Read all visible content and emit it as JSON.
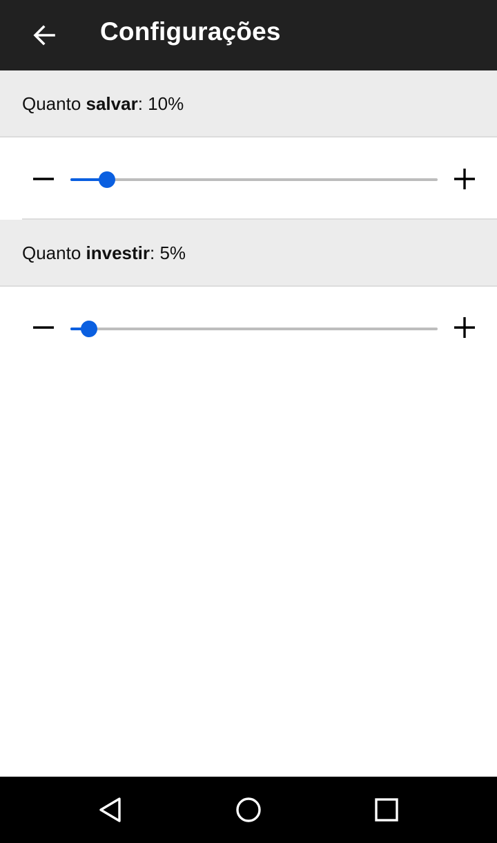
{
  "app_bar": {
    "title": "Configurações",
    "back_icon": "arrow-left-icon"
  },
  "settings": [
    {
      "label_prefix": "Quanto ",
      "label_bold": "salvar",
      "label_suffix": ": ",
      "value_text": "10%",
      "value_fraction": 0.1,
      "minus_icon": "minus-icon",
      "plus_icon": "plus-icon"
    },
    {
      "label_prefix": "Quanto ",
      "label_bold": "investir",
      "label_suffix": ": ",
      "value_text": "5%",
      "value_fraction": 0.05,
      "minus_icon": "minus-icon",
      "plus_icon": "plus-icon"
    }
  ],
  "nav_bar": {
    "back_icon": "triangle-back-icon",
    "home_icon": "circle-home-icon",
    "recents_icon": "square-recents-icon"
  },
  "colors": {
    "app_bar": "#212121",
    "accent": "#0a5fe0",
    "section_header": "#ececec",
    "nav_bar": "#000000"
  }
}
